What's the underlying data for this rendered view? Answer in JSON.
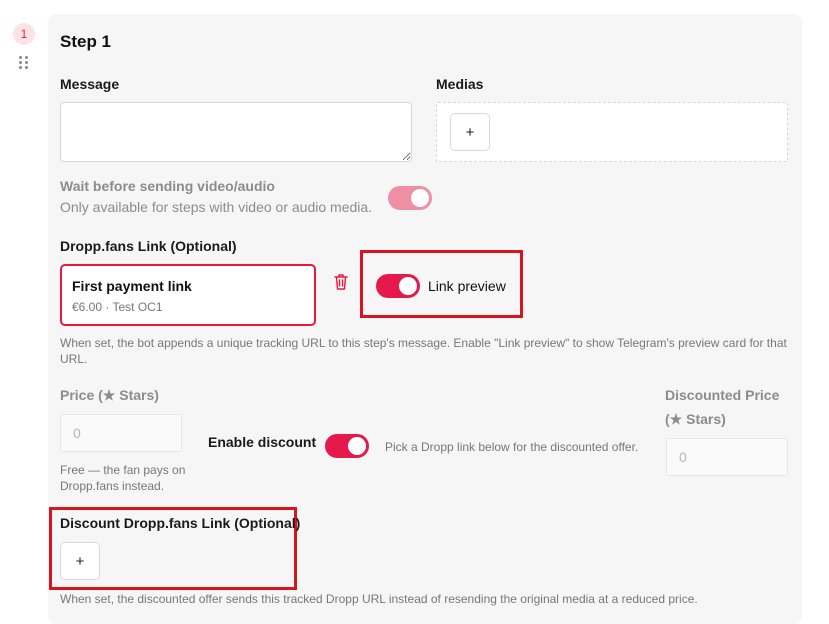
{
  "step": {
    "number": "1",
    "title": "Step 1"
  },
  "message": {
    "label": "Message",
    "value": ""
  },
  "medias": {
    "label": "Medias",
    "add_button": "+"
  },
  "wait": {
    "label": "Wait before sending video/audio",
    "hint": "Only available for steps with video or audio media.",
    "enabled": true
  },
  "dropp_link": {
    "label": "Dropp.fans Link (Optional)",
    "card_title": "First payment link",
    "card_subtitle": "€6.00 · Test OC1",
    "link_preview_label": "Link preview",
    "link_preview_enabled": true,
    "help": "When set, the bot appends a unique tracking URL to this step's message. Enable \"Link preview\" to show Telegram's preview card for that URL."
  },
  "price": {
    "label": "Price (★ Stars)",
    "placeholder": "0",
    "hint": "Free — the fan pays on Dropp.fans instead."
  },
  "discount": {
    "toggle_label": "Enable discount",
    "enabled": true,
    "hint": "Pick a Dropp link below for the discounted offer.",
    "price_label_line1": "Discounted Price",
    "price_label_line2": "(★ Stars)",
    "price_placeholder": "0"
  },
  "discount_link": {
    "label": "Discount Dropp.fans Link (Optional)",
    "add_button": "+",
    "help": "When set, the discounted offer sends this tracked Dropp URL instead of resending the original media at a reduced price."
  },
  "colors": {
    "accent": "#e5194b",
    "highlight_box": "#d8141f",
    "card_bg": "#f6f6f6"
  }
}
